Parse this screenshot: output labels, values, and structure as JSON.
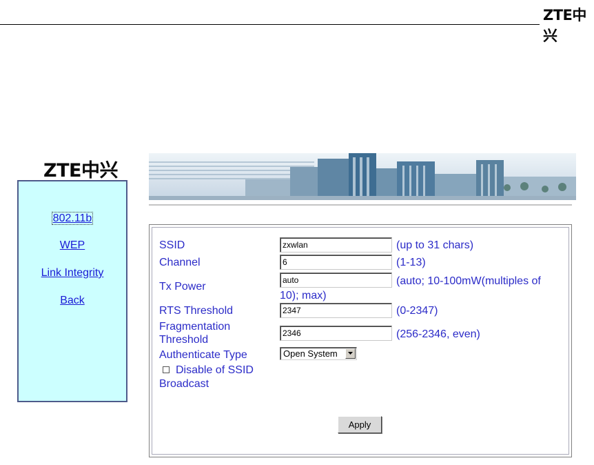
{
  "header": {
    "logo_text": "ZTE中兴"
  },
  "sidebar": {
    "logo_text": "ZTE中兴",
    "items": [
      {
        "label": "802.11b"
      },
      {
        "label": "WEP"
      },
      {
        "label": "Link Integrity"
      },
      {
        "label": "Back"
      }
    ]
  },
  "form": {
    "ssid": {
      "label": "SSID",
      "value": "zxwlan",
      "hint": "(up to 31 chars)"
    },
    "channel": {
      "label": "Channel",
      "value": "6",
      "hint": "(1-13)"
    },
    "tx_power": {
      "label": "Tx Power",
      "value": "auto",
      "hint_line1": "(auto; 10-100mW(multiples of",
      "hint_line2": "10); max)"
    },
    "rts": {
      "label": "RTS Threshold",
      "value": "2347",
      "hint": "(0-2347)"
    },
    "fragmentation": {
      "label_line1": "Fragmentation",
      "label_line2": "Threshold",
      "value": "2346",
      "hint": "(256-2346, even)"
    },
    "auth": {
      "label": "Authenticate Type",
      "selected": "Open System"
    },
    "ssid_broadcast": {
      "label_line1": "Disable of SSID",
      "label_line2": "Broadcast",
      "checked": false
    },
    "apply_label": "Apply"
  },
  "colors": {
    "link": "#1a1ad6",
    "label": "#2b2bc8",
    "sidebar_bg": "#ccffff",
    "sidebar_border": "#4d5a8a"
  }
}
